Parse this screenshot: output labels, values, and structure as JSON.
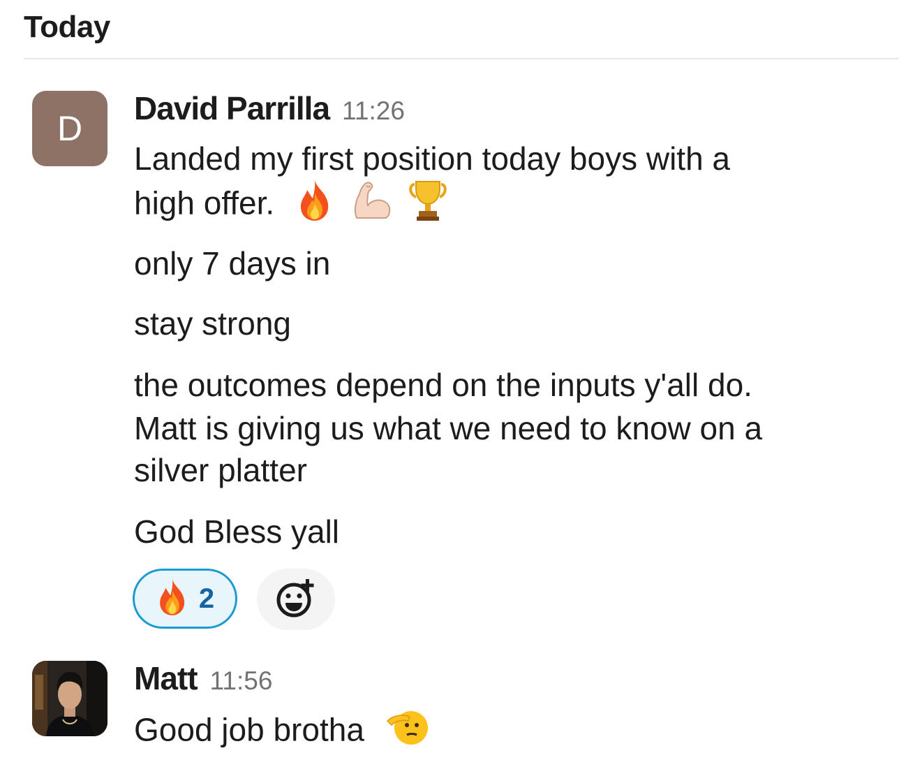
{
  "day_header": "Today",
  "messages": [
    {
      "avatar_letter": "D",
      "sender": "David Parrilla",
      "time": "11:26",
      "lines": [
        "Landed my first position today boys with a",
        "high offer.",
        "only 7 days in",
        "stay strong",
        "the outcomes depend on the inputs y'all do.",
        "Matt is giving us what we need to know on a",
        "silver platter",
        "God Bless yall"
      ],
      "inline_emojis": [
        "fire-emoji",
        "flexed-biceps-emoji",
        "trophy-emoji"
      ],
      "reactions": [
        {
          "emoji": "fire-emoji",
          "count": "2"
        }
      ],
      "add_reaction_icon": "add-reaction-icon"
    },
    {
      "avatar": "user-photo",
      "sender": "Matt",
      "time": "11:56",
      "lines": [
        "Good job brotha"
      ],
      "inline_emojis": [
        "saluting-face-emoji"
      ]
    }
  ],
  "colors": {
    "avatar_bg": "#8f7266",
    "reaction_border": "#1d9bd1",
    "reaction_bg": "#e8f5fa",
    "reaction_count": "#1264a3",
    "timestamp": "#727272"
  }
}
